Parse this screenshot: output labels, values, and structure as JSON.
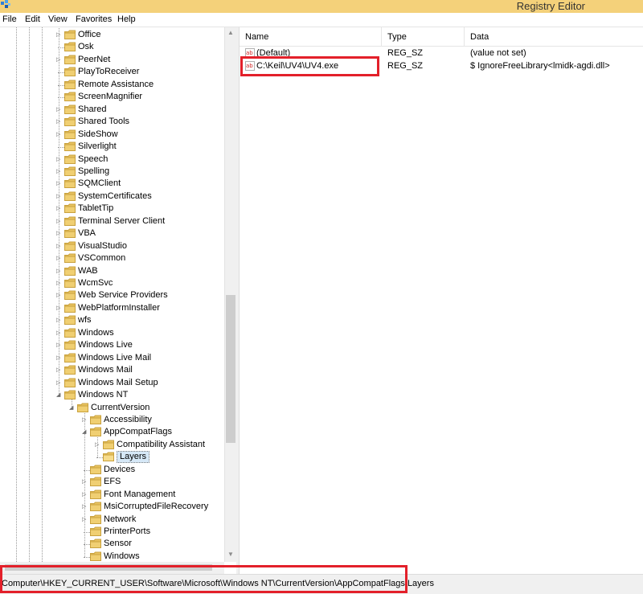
{
  "window": {
    "title": "Registry Editor"
  },
  "menu": {
    "file": "File",
    "edit": "Edit",
    "view": "View",
    "favorites": "Favorites",
    "help": "Help"
  },
  "tree": {
    "items": [
      {
        "label": "Office",
        "depth": 0,
        "expander": "collapsed"
      },
      {
        "label": "Osk",
        "depth": 0,
        "expander": "none"
      },
      {
        "label": "PeerNet",
        "depth": 0,
        "expander": "collapsed"
      },
      {
        "label": "PlayToReceiver",
        "depth": 0,
        "expander": "none"
      },
      {
        "label": "Remote Assistance",
        "depth": 0,
        "expander": "none"
      },
      {
        "label": "ScreenMagnifier",
        "depth": 0,
        "expander": "none"
      },
      {
        "label": "Shared",
        "depth": 0,
        "expander": "collapsed"
      },
      {
        "label": "Shared Tools",
        "depth": 0,
        "expander": "collapsed"
      },
      {
        "label": "SideShow",
        "depth": 0,
        "expander": "collapsed"
      },
      {
        "label": "Silverlight",
        "depth": 0,
        "expander": "none"
      },
      {
        "label": "Speech",
        "depth": 0,
        "expander": "collapsed"
      },
      {
        "label": "Spelling",
        "depth": 0,
        "expander": "collapsed"
      },
      {
        "label": "SQMClient",
        "depth": 0,
        "expander": "collapsed"
      },
      {
        "label": "SystemCertificates",
        "depth": 0,
        "expander": "collapsed"
      },
      {
        "label": "TabletTip",
        "depth": 0,
        "expander": "collapsed"
      },
      {
        "label": "Terminal Server Client",
        "depth": 0,
        "expander": "collapsed"
      },
      {
        "label": "VBA",
        "depth": 0,
        "expander": "collapsed"
      },
      {
        "label": "VisualStudio",
        "depth": 0,
        "expander": "collapsed"
      },
      {
        "label": "VSCommon",
        "depth": 0,
        "expander": "collapsed"
      },
      {
        "label": "WAB",
        "depth": 0,
        "expander": "collapsed"
      },
      {
        "label": "WcmSvc",
        "depth": 0,
        "expander": "collapsed"
      },
      {
        "label": "Web Service Providers",
        "depth": 0,
        "expander": "collapsed"
      },
      {
        "label": "WebPlatformInstaller",
        "depth": 0,
        "expander": "collapsed"
      },
      {
        "label": "wfs",
        "depth": 0,
        "expander": "collapsed"
      },
      {
        "label": "Windows",
        "depth": 0,
        "expander": "collapsed"
      },
      {
        "label": "Windows Live",
        "depth": 0,
        "expander": "collapsed"
      },
      {
        "label": "Windows Live Mail",
        "depth": 0,
        "expander": "collapsed"
      },
      {
        "label": "Windows Mail",
        "depth": 0,
        "expander": "collapsed"
      },
      {
        "label": "Windows Mail Setup",
        "depth": 0,
        "expander": "collapsed"
      },
      {
        "label": "Windows NT",
        "depth": 0,
        "expander": "expanded"
      },
      {
        "label": "CurrentVersion",
        "depth": 1,
        "expander": "expanded"
      },
      {
        "label": "Accessibility",
        "depth": 2,
        "expander": "collapsed"
      },
      {
        "label": "AppCompatFlags",
        "depth": 2,
        "expander": "expanded"
      },
      {
        "label": "Compatibility Assistant",
        "depth": 3,
        "expander": "collapsed"
      },
      {
        "label": "Layers",
        "depth": 3,
        "expander": "none",
        "selected": true
      },
      {
        "label": "Devices",
        "depth": 2,
        "expander": "none"
      },
      {
        "label": "EFS",
        "depth": 2,
        "expander": "collapsed"
      },
      {
        "label": "Font Management",
        "depth": 2,
        "expander": "collapsed"
      },
      {
        "label": "MsiCorruptedFileRecovery",
        "depth": 2,
        "expander": "collapsed"
      },
      {
        "label": "Network",
        "depth": 2,
        "expander": "collapsed"
      },
      {
        "label": "PrinterPorts",
        "depth": 2,
        "expander": "none"
      },
      {
        "label": "Sensor",
        "depth": 2,
        "expander": "none"
      },
      {
        "label": "Windows",
        "depth": 2,
        "expander": "none"
      }
    ]
  },
  "list": {
    "columns": {
      "name": "Name",
      "type": "Type",
      "data": "Data"
    },
    "rows": [
      {
        "name": "(Default)",
        "type": "REG_SZ",
        "data": "(value not set)"
      },
      {
        "name": "C:\\Keil\\UV4\\UV4.exe",
        "type": "REG_SZ",
        "data": "$ IgnoreFreeLibrary<lmidk-agdi.dll>"
      }
    ]
  },
  "status": {
    "path": "Computer\\HKEY_CURRENT_USER\\Software\\Microsoft\\Windows NT\\CurrentVersion\\AppCompatFlags\\Layers"
  },
  "colors": {
    "title_bar": "#f4d17a",
    "highlight": "#e3202a",
    "folder": "#e8c260",
    "selection": "#d6e8f7"
  },
  "icons": {
    "app": "registry-icon",
    "folder": "folder-icon",
    "value": "string-value-icon"
  }
}
